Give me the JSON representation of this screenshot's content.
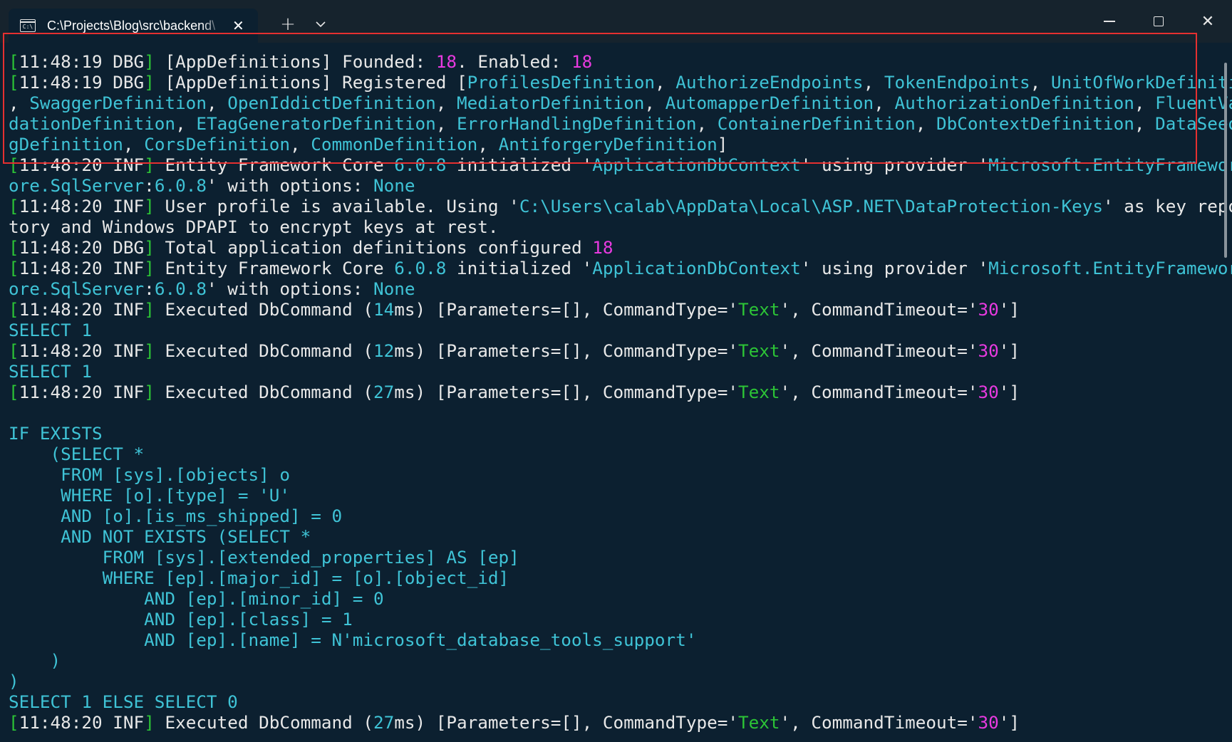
{
  "window": {
    "tab_title": "C:\\Projects\\Blog\\src\\backend\\",
    "tab_icon": "terminal-icon",
    "new_tab_symbol": "+",
    "dropdown_symbol": "⌄",
    "close_tab_symbol": "✕",
    "close_symbol": "✕"
  },
  "colors": {
    "background": "#0c2030",
    "titlebar": "#16232d",
    "text": "#e8e8e8",
    "green": "#2cc436",
    "magenta": "#e83ae0",
    "cyan": "#3fc3d6",
    "highlight_border": "#e53030"
  },
  "terminal": {
    "lines": [
      [
        [
          "g",
          "["
        ],
        [
          "w",
          "11:48:19 DBG"
        ],
        [
          "g",
          "]"
        ],
        [
          "w",
          " [AppDefinitions] Founded: "
        ],
        [
          "m",
          "18"
        ],
        [
          "w",
          ". Enabled: "
        ],
        [
          "m",
          "18"
        ]
      ],
      [
        [
          "g",
          "["
        ],
        [
          "w",
          "11:48:19 DBG"
        ],
        [
          "g",
          "]"
        ],
        [
          "w",
          " [AppDefinitions] Registered ["
        ],
        [
          "c",
          "ProfilesDefinition"
        ],
        [
          "w",
          ", "
        ],
        [
          "c",
          "AuthorizeEndpoints"
        ],
        [
          "w",
          ", "
        ],
        [
          "c",
          "TokenEndpoints"
        ],
        [
          "w",
          ", "
        ],
        [
          "c",
          "UnitOfWorkDefinition"
        ]
      ],
      [
        [
          "w",
          ", "
        ],
        [
          "c",
          "SwaggerDefinition"
        ],
        [
          "w",
          ", "
        ],
        [
          "c",
          "OpenIddictDefinition"
        ],
        [
          "w",
          ", "
        ],
        [
          "c",
          "MediatorDefinition"
        ],
        [
          "w",
          ", "
        ],
        [
          "c",
          "AutomapperDefinition"
        ],
        [
          "w",
          ", "
        ],
        [
          "c",
          "AuthorizationDefinition"
        ],
        [
          "w",
          ", "
        ],
        [
          "c",
          "FluentVali"
        ]
      ],
      [
        [
          "c",
          "dationDefinition"
        ],
        [
          "w",
          ", "
        ],
        [
          "c",
          "ETagGeneratorDefinition"
        ],
        [
          "w",
          ", "
        ],
        [
          "c",
          "ErrorHandlingDefinition"
        ],
        [
          "w",
          ", "
        ],
        [
          "c",
          "ContainerDefinition"
        ],
        [
          "w",
          ", "
        ],
        [
          "c",
          "DbContextDefinition"
        ],
        [
          "w",
          ", "
        ],
        [
          "c",
          "DataSeedin"
        ]
      ],
      [
        [
          "c",
          "gDefinition"
        ],
        [
          "w",
          ", "
        ],
        [
          "c",
          "CorsDefinition"
        ],
        [
          "w",
          ", "
        ],
        [
          "c",
          "CommonDefinition"
        ],
        [
          "w",
          ", "
        ],
        [
          "c",
          "AntiforgeryDefinition"
        ],
        [
          "w",
          "]"
        ]
      ],
      [
        [
          "g",
          "["
        ],
        [
          "w",
          "11:48:20 INF"
        ],
        [
          "g",
          "]"
        ],
        [
          "w",
          " Entity Framework Core "
        ],
        [
          "c",
          "6.0.8"
        ],
        [
          "w",
          " initialized '"
        ],
        [
          "c",
          "ApplicationDbContext"
        ],
        [
          "w",
          "' using provider '"
        ],
        [
          "c",
          "Microsoft.EntityFrameworkC"
        ]
      ],
      [
        [
          "c",
          "ore.SqlServer"
        ],
        [
          "w",
          ":"
        ],
        [
          "c",
          "6.0.8"
        ],
        [
          "w",
          "' with options: "
        ],
        [
          "c",
          "None"
        ]
      ],
      [
        [
          "g",
          "["
        ],
        [
          "w",
          "11:48:20 INF"
        ],
        [
          "g",
          "]"
        ],
        [
          "w",
          " User profile is available. Using '"
        ],
        [
          "c",
          "C:\\Users\\calab\\AppData\\Local\\ASP.NET\\DataProtection-Keys"
        ],
        [
          "w",
          "' as key reposi"
        ]
      ],
      [
        [
          "w",
          "tory and Windows DPAPI to encrypt keys at rest."
        ]
      ],
      [
        [
          "g",
          "["
        ],
        [
          "w",
          "11:48:20 DBG"
        ],
        [
          "g",
          "]"
        ],
        [
          "w",
          " Total application definitions configured "
        ],
        [
          "m",
          "18"
        ]
      ],
      [
        [
          "g",
          "["
        ],
        [
          "w",
          "11:48:20 INF"
        ],
        [
          "g",
          "]"
        ],
        [
          "w",
          " Entity Framework Core "
        ],
        [
          "c",
          "6.0.8"
        ],
        [
          "w",
          " initialized '"
        ],
        [
          "c",
          "ApplicationDbContext"
        ],
        [
          "w",
          "' using provider '"
        ],
        [
          "c",
          "Microsoft.EntityFrameworkC"
        ]
      ],
      [
        [
          "c",
          "ore.SqlServer"
        ],
        [
          "w",
          ":"
        ],
        [
          "c",
          "6.0.8"
        ],
        [
          "w",
          "' with options: "
        ],
        [
          "c",
          "None"
        ]
      ],
      [
        [
          "g",
          "["
        ],
        [
          "w",
          "11:48:20 INF"
        ],
        [
          "g",
          "]"
        ],
        [
          "w",
          " Executed DbCommand ("
        ],
        [
          "c",
          "14"
        ],
        [
          "w",
          "ms) [Parameters=[], CommandType='"
        ],
        [
          "g",
          "Text"
        ],
        [
          "w",
          "', CommandTimeout='"
        ],
        [
          "m",
          "30"
        ],
        [
          "w",
          "']"
        ]
      ],
      [
        [
          "c",
          "SELECT 1"
        ]
      ],
      [
        [
          "g",
          "["
        ],
        [
          "w",
          "11:48:20 INF"
        ],
        [
          "g",
          "]"
        ],
        [
          "w",
          " Executed DbCommand ("
        ],
        [
          "c",
          "12"
        ],
        [
          "w",
          "ms) [Parameters=[], CommandType='"
        ],
        [
          "g",
          "Text"
        ],
        [
          "w",
          "', CommandTimeout='"
        ],
        [
          "m",
          "30"
        ],
        [
          "w",
          "']"
        ]
      ],
      [
        [
          "c",
          "SELECT 1"
        ]
      ],
      [
        [
          "g",
          "["
        ],
        [
          "w",
          "11:48:20 INF"
        ],
        [
          "g",
          "]"
        ],
        [
          "w",
          " Executed DbCommand ("
        ],
        [
          "c",
          "27"
        ],
        [
          "w",
          "ms) [Parameters=[], CommandType='"
        ],
        [
          "g",
          "Text"
        ],
        [
          "w",
          "', CommandTimeout='"
        ],
        [
          "m",
          "30"
        ],
        [
          "w",
          "']"
        ]
      ],
      [],
      [
        [
          "c",
          "IF EXISTS"
        ]
      ],
      [
        [
          "c",
          "    (SELECT *"
        ]
      ],
      [
        [
          "c",
          "     FROM [sys].[objects] o"
        ]
      ],
      [
        [
          "c",
          "     WHERE [o].[type] = 'U'"
        ]
      ],
      [
        [
          "c",
          "     AND [o].[is_ms_shipped] = 0"
        ]
      ],
      [
        [
          "c",
          "     AND NOT EXISTS (SELECT *"
        ]
      ],
      [
        [
          "c",
          "         FROM [sys].[extended_properties] AS [ep]"
        ]
      ],
      [
        [
          "c",
          "         WHERE [ep].[major_id] = [o].[object_id]"
        ]
      ],
      [
        [
          "c",
          "             AND [ep].[minor_id] = 0"
        ]
      ],
      [
        [
          "c",
          "             AND [ep].[class] = 1"
        ]
      ],
      [
        [
          "c",
          "             AND [ep].[name] = N'microsoft_database_tools_support'"
        ]
      ],
      [
        [
          "c",
          "    )"
        ]
      ],
      [
        [
          "c",
          ")"
        ]
      ],
      [
        [
          "c",
          "SELECT 1 ELSE SELECT 0"
        ]
      ],
      [
        [
          "g",
          "["
        ],
        [
          "w",
          "11:48:20 INF"
        ],
        [
          "g",
          "]"
        ],
        [
          "w",
          " Executed DbCommand ("
        ],
        [
          "c",
          "27"
        ],
        [
          "w",
          "ms) [Parameters=[], CommandType='"
        ],
        [
          "g",
          "Text"
        ],
        [
          "w",
          "', CommandTimeout='"
        ],
        [
          "m",
          "30"
        ],
        [
          "w",
          "']"
        ]
      ]
    ]
  }
}
